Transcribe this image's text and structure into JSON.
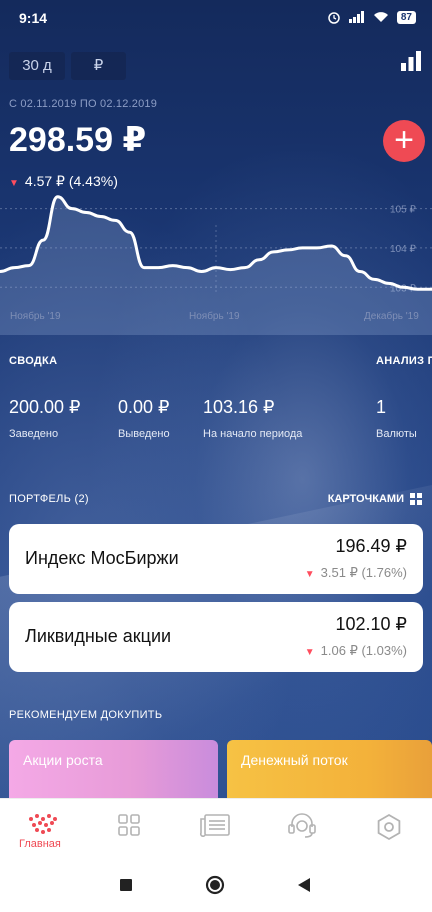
{
  "status_bar": {
    "time": "9:14",
    "battery": "87"
  },
  "controls": {
    "period": "30 д",
    "currency": "₽"
  },
  "portfolio": {
    "date_range": "С 02.11.2019 ПО 02.12.2019",
    "value": "298.59 ₽",
    "change": "4.57 ₽ (4.43%)"
  },
  "chart_data": {
    "type": "area",
    "x_tick_labels": [
      "Ноябрь '19",
      "Ноябрь '19",
      "Декабрь '19"
    ],
    "y_tick_labels": [
      "105 ₽",
      "104 ₽",
      "103 ₽"
    ],
    "ylim": [
      102.6,
      105.6
    ],
    "series": [
      {
        "x": [
          0,
          1,
          2,
          3,
          4,
          5,
          6,
          7,
          8,
          9,
          10,
          11,
          12,
          13,
          14,
          15,
          16,
          17,
          18,
          19,
          20,
          21,
          22,
          23,
          24,
          25,
          26,
          27,
          28,
          29,
          30
        ],
        "values": [
          103.4,
          103.5,
          103.55,
          104.2,
          105.3,
          105.0,
          104.9,
          104.8,
          104.7,
          104.4,
          103.5,
          103.5,
          103.55,
          103.5,
          103.4,
          103.5,
          103.45,
          103.5,
          103.7,
          103.9,
          103.95,
          104.0,
          104.0,
          104.05,
          103.8,
          103.4,
          103.2,
          103.1,
          103.0,
          102.95,
          102.95
        ]
      }
    ],
    "grid": true
  },
  "summary": {
    "title": "СВОДКА",
    "analysis_title": "АНАЛИЗ П",
    "items": [
      {
        "value": "200.00 ₽",
        "label": "Заведено"
      },
      {
        "value": "0.00 ₽",
        "label": "Выведено"
      },
      {
        "value": "103.16 ₽",
        "label": "На начало периода"
      },
      {
        "value": "1",
        "label": "Валюты"
      }
    ]
  },
  "portfolio_list": {
    "title": "ПОРТФЕЛЬ (2)",
    "view_toggle": "КАРТОЧКАМИ",
    "cards": [
      {
        "name": "Индекс МосБиржи",
        "amount": "196.49 ₽",
        "change": "3.51 ₽ (1.76%)"
      },
      {
        "name": "Ликвидные акции",
        "amount": "102.10 ₽",
        "change": "1.06 ₽ (1.03%)"
      }
    ]
  },
  "recommend": {
    "title": "РЕКОМЕНДУЕМ ДОКУПИТЬ",
    "items": [
      {
        "label": "Акции роста",
        "color": "#f4a9e6"
      },
      {
        "label": "Денежный поток",
        "color": "#f6c244"
      }
    ]
  },
  "bottom_nav": {
    "home_label": "Главная",
    "accent": "#ef4a54",
    "items": [
      "home-icon",
      "grid-icon",
      "news-icon",
      "support-icon",
      "settings-icon"
    ]
  }
}
